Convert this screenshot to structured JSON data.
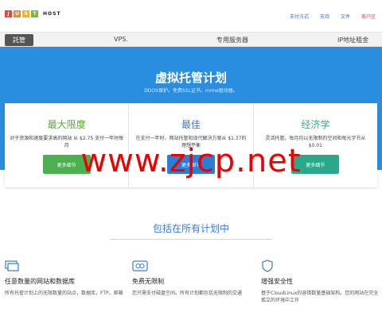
{
  "brand": {
    "letters": [
      "J",
      "U",
      "S",
      "T"
    ],
    "letter_colors": [
      "#e8463a",
      "#f08a24",
      "#f3b61f",
      "#7cb93c"
    ],
    "host": "HOST"
  },
  "toplinks": [
    "支付方式",
    "支持",
    "文件",
    "客户区"
  ],
  "nav": {
    "active": "託管",
    "items": [
      "VPS.",
      "专用服务器",
      "IP地址租金"
    ]
  },
  "hero": {
    "title": "虚拟托管计划",
    "subtitle": "DDOS保护。免费SSL证书。nvme驱动器。",
    "bg_color": "#2a8ee0"
  },
  "plans": [
    {
      "title": "最大限度",
      "title_color": "#5aaa2e",
      "desc": "对于资源和速度要求高的网站 从 $2.75 支付一年时每月",
      "button": "更多细节",
      "button_color": "#4caf50"
    },
    {
      "title": "最佳",
      "title_color": "#3a7bd5",
      "desc": "在支付一年时，网站托管和现代解决方案从 $1.37的理想平衡",
      "button": "更多细节",
      "button_color": "#2a7fd4"
    },
    {
      "title": "经济学",
      "title_color": "#35b08a",
      "desc": "灵活托管。每月均以无限制的空间和每光字节从 $0.01",
      "button": "更多细节",
      "button_color": "#2ba889"
    }
  ],
  "features_title": "包括在所有计划中",
  "features": [
    {
      "icon": "monitor-icon",
      "title": "任意数量的网站和数据库",
      "desc": "所有托管计划上的无限数量的站点，数据库，FTP，邮箱"
    },
    {
      "icon": "infinity-icon",
      "title": "免费无限制",
      "desc": "您只需支付磁盘空间。所有计划都包括无限制的交通"
    },
    {
      "icon": "shield-icon",
      "title": "增强安全性",
      "desc": "基于CloudLinux的容错数量基础架构。您的网站在完全孤立的环境中工作"
    }
  ],
  "watermark": "www.zjcp.net"
}
